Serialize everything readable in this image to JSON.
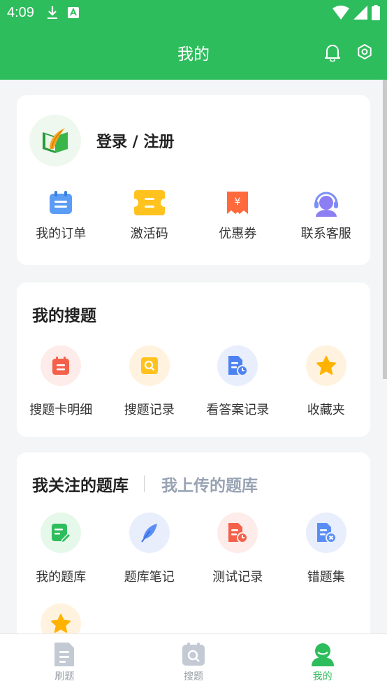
{
  "status_bar": {
    "time": "4:09"
  },
  "header": {
    "title": "我的"
  },
  "profile": {
    "login_label": "登录 / 注册"
  },
  "quick_actions": [
    {
      "label": "我的订单",
      "icon": "order-icon"
    },
    {
      "label": "激活码",
      "icon": "activation-code-icon"
    },
    {
      "label": "优惠券",
      "icon": "coupon-icon"
    },
    {
      "label": "联系客服",
      "icon": "customer-service-icon"
    }
  ],
  "my_search": {
    "title": "我的搜题",
    "items": [
      {
        "label": "搜题卡明细",
        "icon": "search-card-icon"
      },
      {
        "label": "搜题记录",
        "icon": "search-record-icon"
      },
      {
        "label": "看答案记录",
        "icon": "answer-record-icon"
      },
      {
        "label": "收藏夹",
        "icon": "favorites-star-icon"
      }
    ]
  },
  "question_bank": {
    "tab_followed": "我关注的题库",
    "tab_uploaded": "我上传的题库",
    "items": [
      {
        "label": "我的题库",
        "icon": "my-bank-icon"
      },
      {
        "label": "题库笔记",
        "icon": "notes-feather-icon"
      },
      {
        "label": "测试记录",
        "icon": "test-record-icon"
      },
      {
        "label": "错题集",
        "icon": "wrong-questions-icon"
      }
    ]
  },
  "tab_bar": {
    "items": [
      {
        "label": "刷题",
        "icon": "practice-icon",
        "active": false
      },
      {
        "label": "搜题",
        "icon": "search-tab-icon",
        "active": false
      },
      {
        "label": "我的",
        "icon": "profile-tab-icon",
        "active": true
      }
    ]
  },
  "colors": {
    "brand_green": "#2ebd5c",
    "inactive_tab": "#98a3b3"
  }
}
